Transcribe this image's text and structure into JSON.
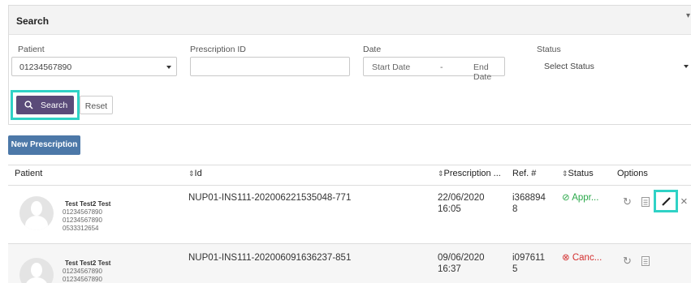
{
  "search": {
    "title": "Search",
    "patient_label": "Patient",
    "patient_value": "01234567890",
    "prescription_id_label": "Prescription ID",
    "prescription_id_value": "",
    "date_label": "Date",
    "start_placeholder": "Start Date",
    "date_separator": "-",
    "end_placeholder": "End Date",
    "status_label": "Status",
    "status_value": "Select Status",
    "search_button": "Search",
    "reset_button": "Reset"
  },
  "new_prescription_button": "New Prescription",
  "table": {
    "headers": {
      "patient": "Patient",
      "id": "Id",
      "prescription_date": "Prescription ...",
      "ref": "Ref. #",
      "status": "Status",
      "options": "Options"
    },
    "rows": [
      {
        "patient_name": "Test Test2 Test",
        "phone1": "01234567890",
        "phone2": "01234567890",
        "phone3": "0533312654",
        "id": "NUP01-INS111-202006221535048-771",
        "date": "22/06/2020",
        "time": "16:05",
        "ref_line1": "i368894",
        "ref_line2": "8",
        "status": "Appr..."
      },
      {
        "patient_name": "Test Test2 Test",
        "phone1": "01234567890",
        "phone2": "01234567890",
        "id": "NUP01-INS111-202006091636237-851",
        "date": "09/06/2020",
        "time": "16:37",
        "ref_line1": "i097611",
        "ref_line2": "5",
        "status": "Canc..."
      }
    ]
  },
  "colors": {
    "highlight": "#2fd2c6",
    "search_button_bg": "#5a4b79",
    "new_button_bg": "#4c78a8",
    "approved": "#2aa84a",
    "cancelled": "#d32f2f"
  },
  "icons": {
    "search": "search-icon",
    "refresh": "refresh-icon",
    "document": "document-icon",
    "edit": "pencil-icon",
    "delete": "close-icon",
    "approved": "check-circle-icon",
    "cancelled": "x-circle-icon",
    "sort": "sort-icon",
    "avatar": "user-avatar-icon",
    "dropdown": "chevron-down-icon"
  }
}
